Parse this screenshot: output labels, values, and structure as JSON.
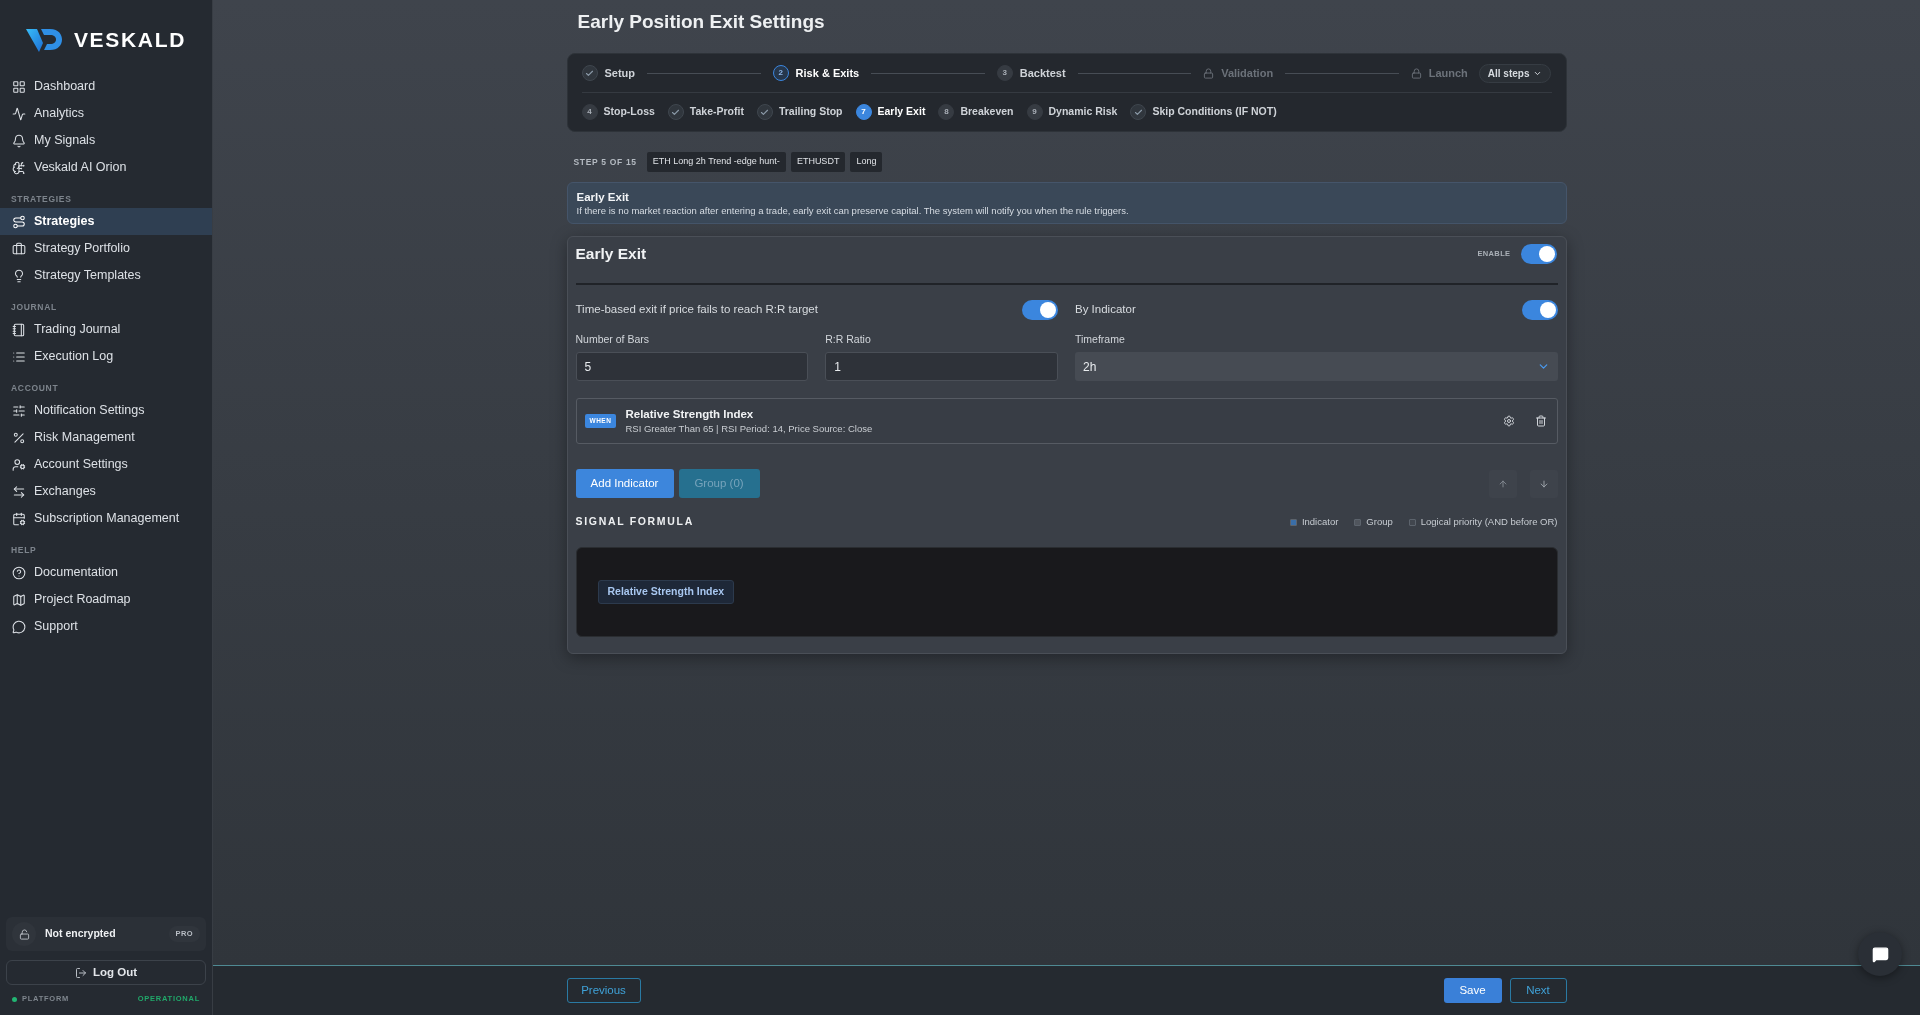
{
  "sidebar": {
    "brand": "VESKALD",
    "groups": [
      {
        "items": [
          {
            "label": "Dashboard",
            "selected": false
          },
          {
            "label": "Analytics",
            "selected": false
          },
          {
            "label": "My Signals",
            "selected": false
          },
          {
            "label": "Veskald AI Orion",
            "selected": false
          }
        ]
      },
      {
        "heading": "STRATEGIES",
        "items": [
          {
            "label": "Strategies",
            "selected": true
          },
          {
            "label": "Strategy Portfolio",
            "selected": false
          },
          {
            "label": "Strategy Templates",
            "selected": false
          }
        ]
      },
      {
        "heading": "JOURNAL",
        "items": [
          {
            "label": "Trading Journal",
            "selected": false
          },
          {
            "label": "Execution Log",
            "selected": false
          }
        ]
      },
      {
        "heading": "ACCOUNT",
        "items": [
          {
            "label": "Notification Settings",
            "selected": false
          },
          {
            "label": "Risk Management",
            "selected": false
          },
          {
            "label": "Account Settings",
            "selected": false
          },
          {
            "label": "Exchanges",
            "selected": false
          },
          {
            "label": "Subscription Management",
            "selected": false
          }
        ]
      },
      {
        "heading": "HELP",
        "items": [
          {
            "label": "Documentation",
            "selected": false
          },
          {
            "label": "Project Roadmap",
            "selected": false
          },
          {
            "label": "Support",
            "selected": false
          }
        ]
      }
    ],
    "encryption": {
      "label": "Not encrypted",
      "plan": "PRO"
    },
    "logout_button": "Log Out",
    "platform": {
      "label": "PLATFORM",
      "status": "OPERATIONAL"
    }
  },
  "page_title": "Early Position Exit Settings",
  "stepper": {
    "steps": [
      {
        "label": "Setup",
        "kind": "done",
        "selected": false
      },
      {
        "label": "Risk & Exits",
        "kind": "numbered",
        "number": "2",
        "selected": true
      },
      {
        "label": "Backtest",
        "kind": "numbered",
        "number": "3",
        "selected": false
      },
      {
        "label": "Validation",
        "kind": "locked",
        "selected": false
      },
      {
        "label": "Launch",
        "kind": "locked",
        "selected": false
      }
    ],
    "all_steps_button": "All steps",
    "substeps": [
      {
        "label": "Stop-Loss",
        "kind": "numbered",
        "number": "4",
        "selected": false
      },
      {
        "label": "Take-Profit",
        "kind": "done",
        "selected": false
      },
      {
        "label": "Trailing Stop",
        "kind": "done",
        "selected": false
      },
      {
        "label": "Early Exit",
        "kind": "numbered",
        "number": "7",
        "selected": true
      },
      {
        "label": "Breakeven",
        "kind": "numbered",
        "number": "8",
        "selected": false
      },
      {
        "label": "Dynamic Risk",
        "kind": "numbered",
        "number": "9",
        "selected": false
      },
      {
        "label": "Skip Conditions (IF NOT)",
        "kind": "done",
        "selected": false
      }
    ]
  },
  "step_info": {
    "label": "STEP 5 OF 15",
    "tags": [
      "ETH Long 2h Trend -edge hunt-",
      "ETHUSDT",
      "Long"
    ]
  },
  "info_box": {
    "title": "Early Exit",
    "text": "If there is no market reaction after entering a trade, early exit can preserve capital. The system will notify you when the rule triggers."
  },
  "card": {
    "title": "Early Exit",
    "enable_label": "ENABLE",
    "enabled": true,
    "time_exit": {
      "label": "Time-based exit if price fails to reach R:R target",
      "on": true
    },
    "by_indicator": {
      "label": "By Indicator",
      "on": true
    },
    "fields": [
      {
        "label": "Number of Bars",
        "value": "5",
        "kind": "input"
      },
      {
        "label": "R:R Ratio",
        "value": "1",
        "kind": "input"
      },
      {
        "label": "Timeframe",
        "value": "2h",
        "kind": "select"
      }
    ],
    "conditions": [
      {
        "badge": "WHEN",
        "title": "Relative Strength Index",
        "detail": "RSI Greater Than 65 | RSI Period: 14, Price Source: Close"
      }
    ],
    "add_indicator_button": "Add Indicator",
    "group_button": {
      "label": "Group (0)",
      "disabled": true
    },
    "signal_formula": {
      "title": "SIGNAL FORMULA",
      "legend": [
        {
          "label": "Indicator",
          "color": "#3a6ea8"
        },
        {
          "label": "Group",
          "color": "#50555d"
        },
        {
          "label": "Logical priority (AND before OR)",
          "color": "#41464e"
        }
      ],
      "tokens": [
        "Relative Strength Index"
      ]
    }
  },
  "footer": {
    "previous": "Previous",
    "save": "Save",
    "next": "Next"
  }
}
